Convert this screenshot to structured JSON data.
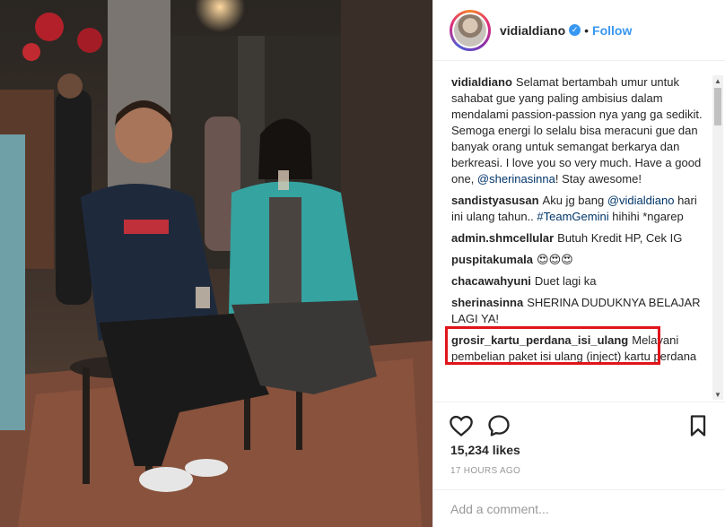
{
  "post": {
    "image_alt": "",
    "author": "vidialdiano",
    "follow_label": "Follow",
    "separator": "•",
    "likes": "15,234 likes",
    "time": "17 HOURS AGO",
    "comment_placeholder": "Add a comment...",
    "colors": {
      "link": "#3897f0",
      "mention": "#003569",
      "highlight": "#e0141a"
    }
  },
  "caption": {
    "user": "vidialdiano",
    "text_1": "Selamat bertambah umur untuk sahabat gue yang paling ambisius dalam mendalami passion-passion nya yang ga sedikit. Semoga energi lo selalu bisa meracuni gue dan banyak orang untuk semangat berkarya dan berkreasi. I love you so very much. Have a good one, ",
    "mention": "@sherinasinna",
    "text_2": "! Stay awesome!"
  },
  "comments": [
    {
      "user": "sandistyasusan",
      "text_1": "Aku jg bang ",
      "mention": "@vidialdiano",
      "text_2": " hari ini ulang tahun.. ",
      "hashtag": "#TeamGemini",
      "text_3": " hihihi *ngarep"
    },
    {
      "user": "admin.shmcellular",
      "text": "Butuh Kredit HP, Cek IG"
    },
    {
      "user": "puspitakumala",
      "text": "😍😍😍"
    },
    {
      "user": "chacawahyuni",
      "text": "Duet lagi ka"
    },
    {
      "user": "sherinasinna",
      "text": "SHERINA DUDUKNYA BELAJAR LAGI YA!"
    },
    {
      "user": "grosir_kartu_perdana_isi_ulang",
      "text": "Melayani pembelian paket isi ulang (inject) kartu perdana"
    }
  ]
}
